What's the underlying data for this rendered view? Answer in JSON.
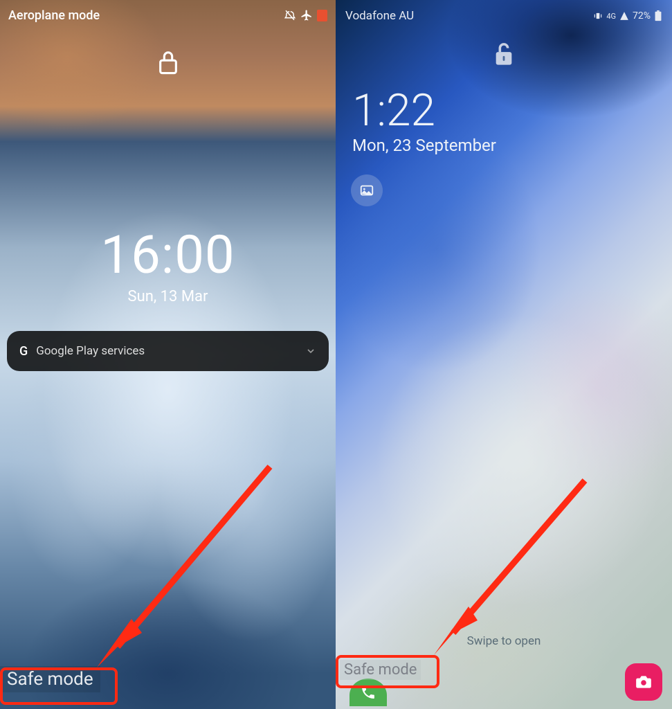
{
  "left": {
    "statusbar": {
      "title": "Aeroplane mode"
    },
    "time": "16:00",
    "date": "Sun, 13 Mar",
    "notification": {
      "source_glyph": "G",
      "title": "Google Play services"
    },
    "safemode_label": "Safe mode"
  },
  "right": {
    "statusbar": {
      "carrier": "Vodafone AU",
      "battery": "72%"
    },
    "time": "1:22",
    "date": "Mon, 23 September",
    "swipe_hint": "Swipe to open",
    "safemode_label": "Safe mode"
  },
  "colors": {
    "highlight": "#ff2a13"
  }
}
